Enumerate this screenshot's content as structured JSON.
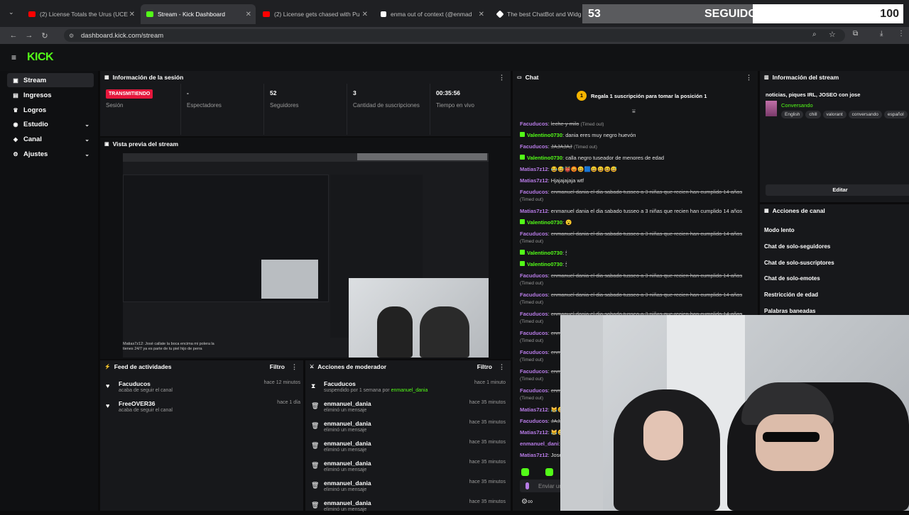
{
  "tabs": [
    {
      "label": "(2) License Totals the Urus (UCE",
      "fav": "#ff0000"
    },
    {
      "label": "Stream - Kick Dashboard",
      "fav": "#53fc18"
    },
    {
      "label": "(2) License gets chased with Pu",
      "fav": "#ff0000"
    },
    {
      "label": "enma out of context (@enmad",
      "fav": "#ffffff"
    },
    {
      "label": "The best ChatBot and Widge",
      "fav": "#ffffff"
    }
  ],
  "url": "dashboard.kick.com/stream",
  "logo": "KICK",
  "follower_goal": {
    "current": "53",
    "label": "SEGUIDORES",
    "target": "100",
    "progress": 0.53
  },
  "sidebar": [
    {
      "label": "Stream",
      "icon": "stream-icon"
    },
    {
      "label": "Ingresos",
      "icon": "money-icon"
    },
    {
      "label": "Logros",
      "icon": "trophy-icon"
    },
    {
      "label": "Estudio",
      "icon": "studio-icon"
    },
    {
      "label": "Canal",
      "icon": "channel-icon"
    },
    {
      "label": "Ajustes",
      "icon": "gear-icon"
    }
  ],
  "session": {
    "title": "Información de la sesión",
    "badge": "TRANSMITIENDO",
    "badge_label": "Sesión",
    "stats": [
      {
        "value": "-",
        "label": "Espectadores"
      },
      {
        "value": "52",
        "label": "Seguidores"
      },
      {
        "value": "3",
        "label": "Cantidad de suscripciones"
      },
      {
        "value": "00:35:56",
        "label": "Tiempo en vivo"
      }
    ]
  },
  "preview": {
    "title": "Vista previa del stream",
    "caption": "Matias7z12: José callate la boca encima mi polera la tienes 24/7 ya es parte de tu piel hijo de perra"
  },
  "feed": {
    "title": "Feed de actividades",
    "filter": "Filtro",
    "items": [
      {
        "name": "Facuducos",
        "sub": "acaba de seguir el canal",
        "time": "hace 12 minutos"
      },
      {
        "name": "FreeOVER36",
        "sub": "acaba de seguir el canal",
        "time": "hace 1 día"
      }
    ]
  },
  "modactions": {
    "title": "Acciones de moderador",
    "filter": "Filtro",
    "items": [
      {
        "name": "Facuducos",
        "sub": "suspendido por 1 semana por",
        "by": "enmanuel_dania",
        "time": "hace 1 minuto"
      },
      {
        "name": "enmanuel_dania",
        "sub": "eliminó un mensaje",
        "by": "",
        "time": "hace 35 minutos"
      },
      {
        "name": "enmanuel_dania",
        "sub": "eliminó un mensaje",
        "by": "",
        "time": "hace 35 minutos"
      },
      {
        "name": "enmanuel_dania",
        "sub": "eliminó un mensaje",
        "by": "",
        "time": "hace 35 minutos"
      },
      {
        "name": "enmanuel_dania",
        "sub": "eliminó un mensaje",
        "by": "",
        "time": "hace 35 minutos"
      },
      {
        "name": "enmanuel_dania",
        "sub": "eliminó un mensaje",
        "by": "",
        "time": "hace 35 minutos"
      },
      {
        "name": "enmanuel_dania",
        "sub": "eliminó un mensaje",
        "by": "",
        "time": "hace 35 minutos"
      }
    ]
  },
  "chat": {
    "title": "Chat",
    "pinned": "Regala 1 suscripción para tomar la posición 1",
    "pinned_rank": "1",
    "input_placeholder": "Enviar un mensaje",
    "messages": [
      {
        "user": "Facuducos",
        "text": "leche y milo",
        "timeout": "(Timed out)",
        "struck": true,
        "green": false
      },
      {
        "user": "Valentino0730",
        "text": "dania eres muy negro huevón",
        "timeout": "",
        "struck": false,
        "green": true
      },
      {
        "user": "Facuducos",
        "text": "JAJAJAJ",
        "timeout": "(Timed out)",
        "struck": true,
        "green": false
      },
      {
        "user": "Valentino0730",
        "text": "calla negro tuseador de menores de edad",
        "timeout": "",
        "struck": false,
        "green": true
      },
      {
        "user": "Matias7z12",
        "text": "😂😅👹😡😀🟦😄😄😆😅",
        "timeout": "",
        "struck": false,
        "green": false
      },
      {
        "user": "Matias7z12",
        "text": "Hjajajajaja wtf",
        "timeout": "",
        "struck": false,
        "green": false
      },
      {
        "user": "Facuducos",
        "text": "enmanuel dania el dia sabado tusseo a 3 niñas que recien han cumplido 14 años",
        "timeout": "(Timed out)",
        "struck": true,
        "green": false
      },
      {
        "user": "Matias7z12",
        "text": "enmanuel dania el dia sabado tusseo a 3 niñas que recien han cumplido 14 años",
        "timeout": "",
        "struck": false,
        "green": false
      },
      {
        "user": "Valentino0730",
        "text": "😮",
        "timeout": "",
        "struck": false,
        "green": true
      },
      {
        "user": "Facuducos",
        "text": "enmanuel dania el dia sabado tusseo a 3 niñas que recien han cumplido 14 años",
        "timeout": "(Timed out)",
        "struck": true,
        "green": false
      },
      {
        "user": "Valentino0730",
        "text": "🕯",
        "timeout": "",
        "struck": false,
        "green": true
      },
      {
        "user": "Valentino0730",
        "text": "🕯",
        "timeout": "",
        "struck": false,
        "green": true
      },
      {
        "user": "Facuducos",
        "text": "enmanuel dania el dia sabado tusseo a 3 niñas que recien han cumplido 14 años",
        "timeout": "(Timed out)",
        "struck": true,
        "green": false
      },
      {
        "user": "Facuducos",
        "text": "enmanuel dania el dia sabado tusseo a 3 niñas que recien han cumplido 14 años",
        "timeout": "(Timed out)",
        "struck": true,
        "green": false
      },
      {
        "user": "Facuducos",
        "text": "enmanuel dania el dia sabado tusseo a 3 niñas que recien han cumplido 14 años",
        "timeout": "(Timed out)",
        "struck": true,
        "green": false
      },
      {
        "user": "Facuducos",
        "text": "enmanuel dania el dia sabado tusseo a 3 niñas que recien han cumplido 14 años",
        "timeout": "(Timed out)",
        "struck": true,
        "green": false
      },
      {
        "user": "Facuducos",
        "text": "enmanuel dania el dia sabado tusseo a 3 niñas que recien han cumplido 14 años",
        "timeout": "(Timed out)",
        "struck": true,
        "green": false
      },
      {
        "user": "Facuducos",
        "text": "enmanuel dania el dia sabado tusseo a 3 niñas que recien han cumplido 14 años",
        "timeout": "(Timed out)",
        "struck": true,
        "green": false
      },
      {
        "user": "Facuducos",
        "text": "enmanuel dania el dia sabado tusseo a 3 niñas que recien han cumplido 14 años",
        "timeout": "(Timed out)",
        "struck": true,
        "green": false
      },
      {
        "user": "Matias7z12",
        "text": "😹😅",
        "timeout": "",
        "struck": false,
        "green": false
      },
      {
        "user": "Facuducos",
        "text": "JAJAJ",
        "timeout": "",
        "struck": true,
        "green": false
      },
      {
        "user": "Matias7z12",
        "text": "😹😅",
        "timeout": "",
        "struck": false,
        "green": false
      },
      {
        "user": "enmanuel_dani",
        "text": "",
        "timeout": "",
        "struck": false,
        "green": false
      },
      {
        "user": "Matias7z12",
        "text": "José",
        "timeout": "",
        "struck": false,
        "green": false
      }
    ]
  },
  "stream_info": {
    "title": "Información del stream",
    "stream_title": "noticias, piques IRL, JOSEO con jose",
    "category": "Conversando",
    "tags": [
      "English",
      "chill",
      "valorant",
      "conversando",
      "español"
    ],
    "edit": "Editar"
  },
  "channel_actions": {
    "title": "Acciones de canal",
    "items": [
      "Modo lento",
      "Chat de solo-seguidores",
      "Chat de solo-suscriptores",
      "Chat de solo-emotes",
      "Restricción de edad",
      "Palabras baneadas"
    ]
  },
  "colors": {
    "accent": "#53fc18",
    "live": "#e5173c",
    "bg": "#0b0b0c",
    "panel": "#17181b"
  }
}
